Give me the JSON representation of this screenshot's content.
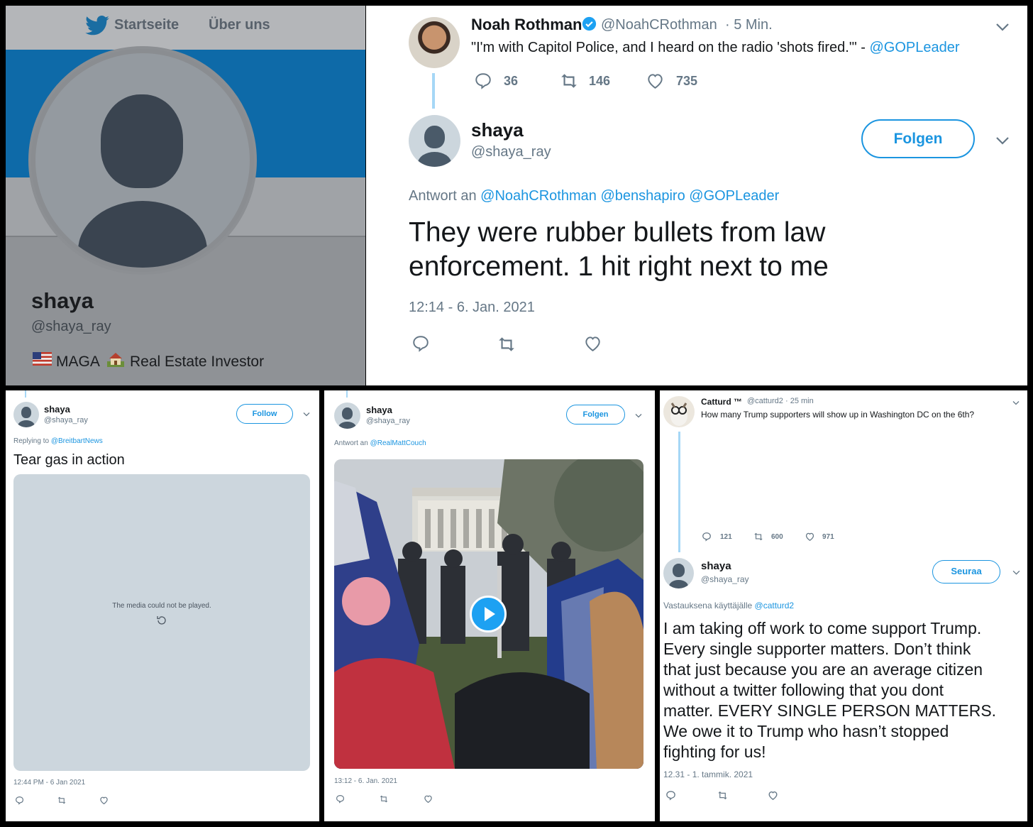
{
  "profile": {
    "nav_home": "Startseite",
    "nav_about": "Über uns",
    "name": "shaya",
    "handle": "@shaya_ray",
    "bio_part1": "MAGA",
    "bio_part2": "Real Estate Investor",
    "colors": {
      "banner": "#0e6aa8",
      "nav_bg": "#e8eaec"
    }
  },
  "main_tweet": {
    "parent": {
      "name": "Noah Rothman",
      "handle": "@NoahCRothman",
      "time": "· 5 Min.",
      "text": "\"I'm with Capitol Police, and I heard on the radio 'shots fired.'\" -",
      "mention": "@GOPLeader",
      "replies": "36",
      "retweets": "146",
      "likes": "735"
    },
    "name": "shaya",
    "handle": "@shaya_ray",
    "follow_label": "Folgen",
    "reply_prefix": "Antwort an",
    "reply_mentions": "@NoahCRothman @benshapiro @GOPLeader",
    "text_line1": "They were rubber bullets from law",
    "text_line2": "enforcement. 1 hit right next to me",
    "timestamp": "12:14 - 6. Jan. 2021"
  },
  "tweet_teargas": {
    "name": "shaya",
    "handle": "@shaya_ray",
    "follow_label": "Follow",
    "reply_prefix": "Replying to",
    "reply_mention": "@BreitbartNews",
    "text": "Tear gas in action",
    "media_error": "The media could not be played.",
    "timestamp": "12:44 PM - 6 Jan 2021"
  },
  "tweet_video": {
    "name": "shaya",
    "handle": "@shaya_ray",
    "follow_label": "Folgen",
    "reply_prefix": "Antwort an",
    "reply_mention": "@RealMattCouch",
    "timestamp": "13:12 - 6. Jan. 2021"
  },
  "tweet_catturd": {
    "parent": {
      "name": "Catturd ™",
      "handle": "@catturd2",
      "time": "· 25 min",
      "text": "How many Trump supporters will show up in Washington DC on the 6th?",
      "replies": "121",
      "retweets": "600",
      "likes": "971"
    },
    "name": "shaya",
    "handle": "@shaya_ray",
    "follow_label": "Seuraa",
    "reply_prefix": "Vastauksena käyttäjälle",
    "reply_mention": "@catturd2",
    "text_lines": [
      "I am taking off work to come support Trump.",
      "Every single supporter matters. Don’t think",
      "that just because you are an average citizen",
      "without a twitter following that you dont",
      "matter. EVERY SINGLE PERSON MATTERS.",
      "We owe it to Trump who hasn’t stopped",
      "fighting for us!"
    ],
    "timestamp": "12.31 - 1. tammik. 2021"
  }
}
